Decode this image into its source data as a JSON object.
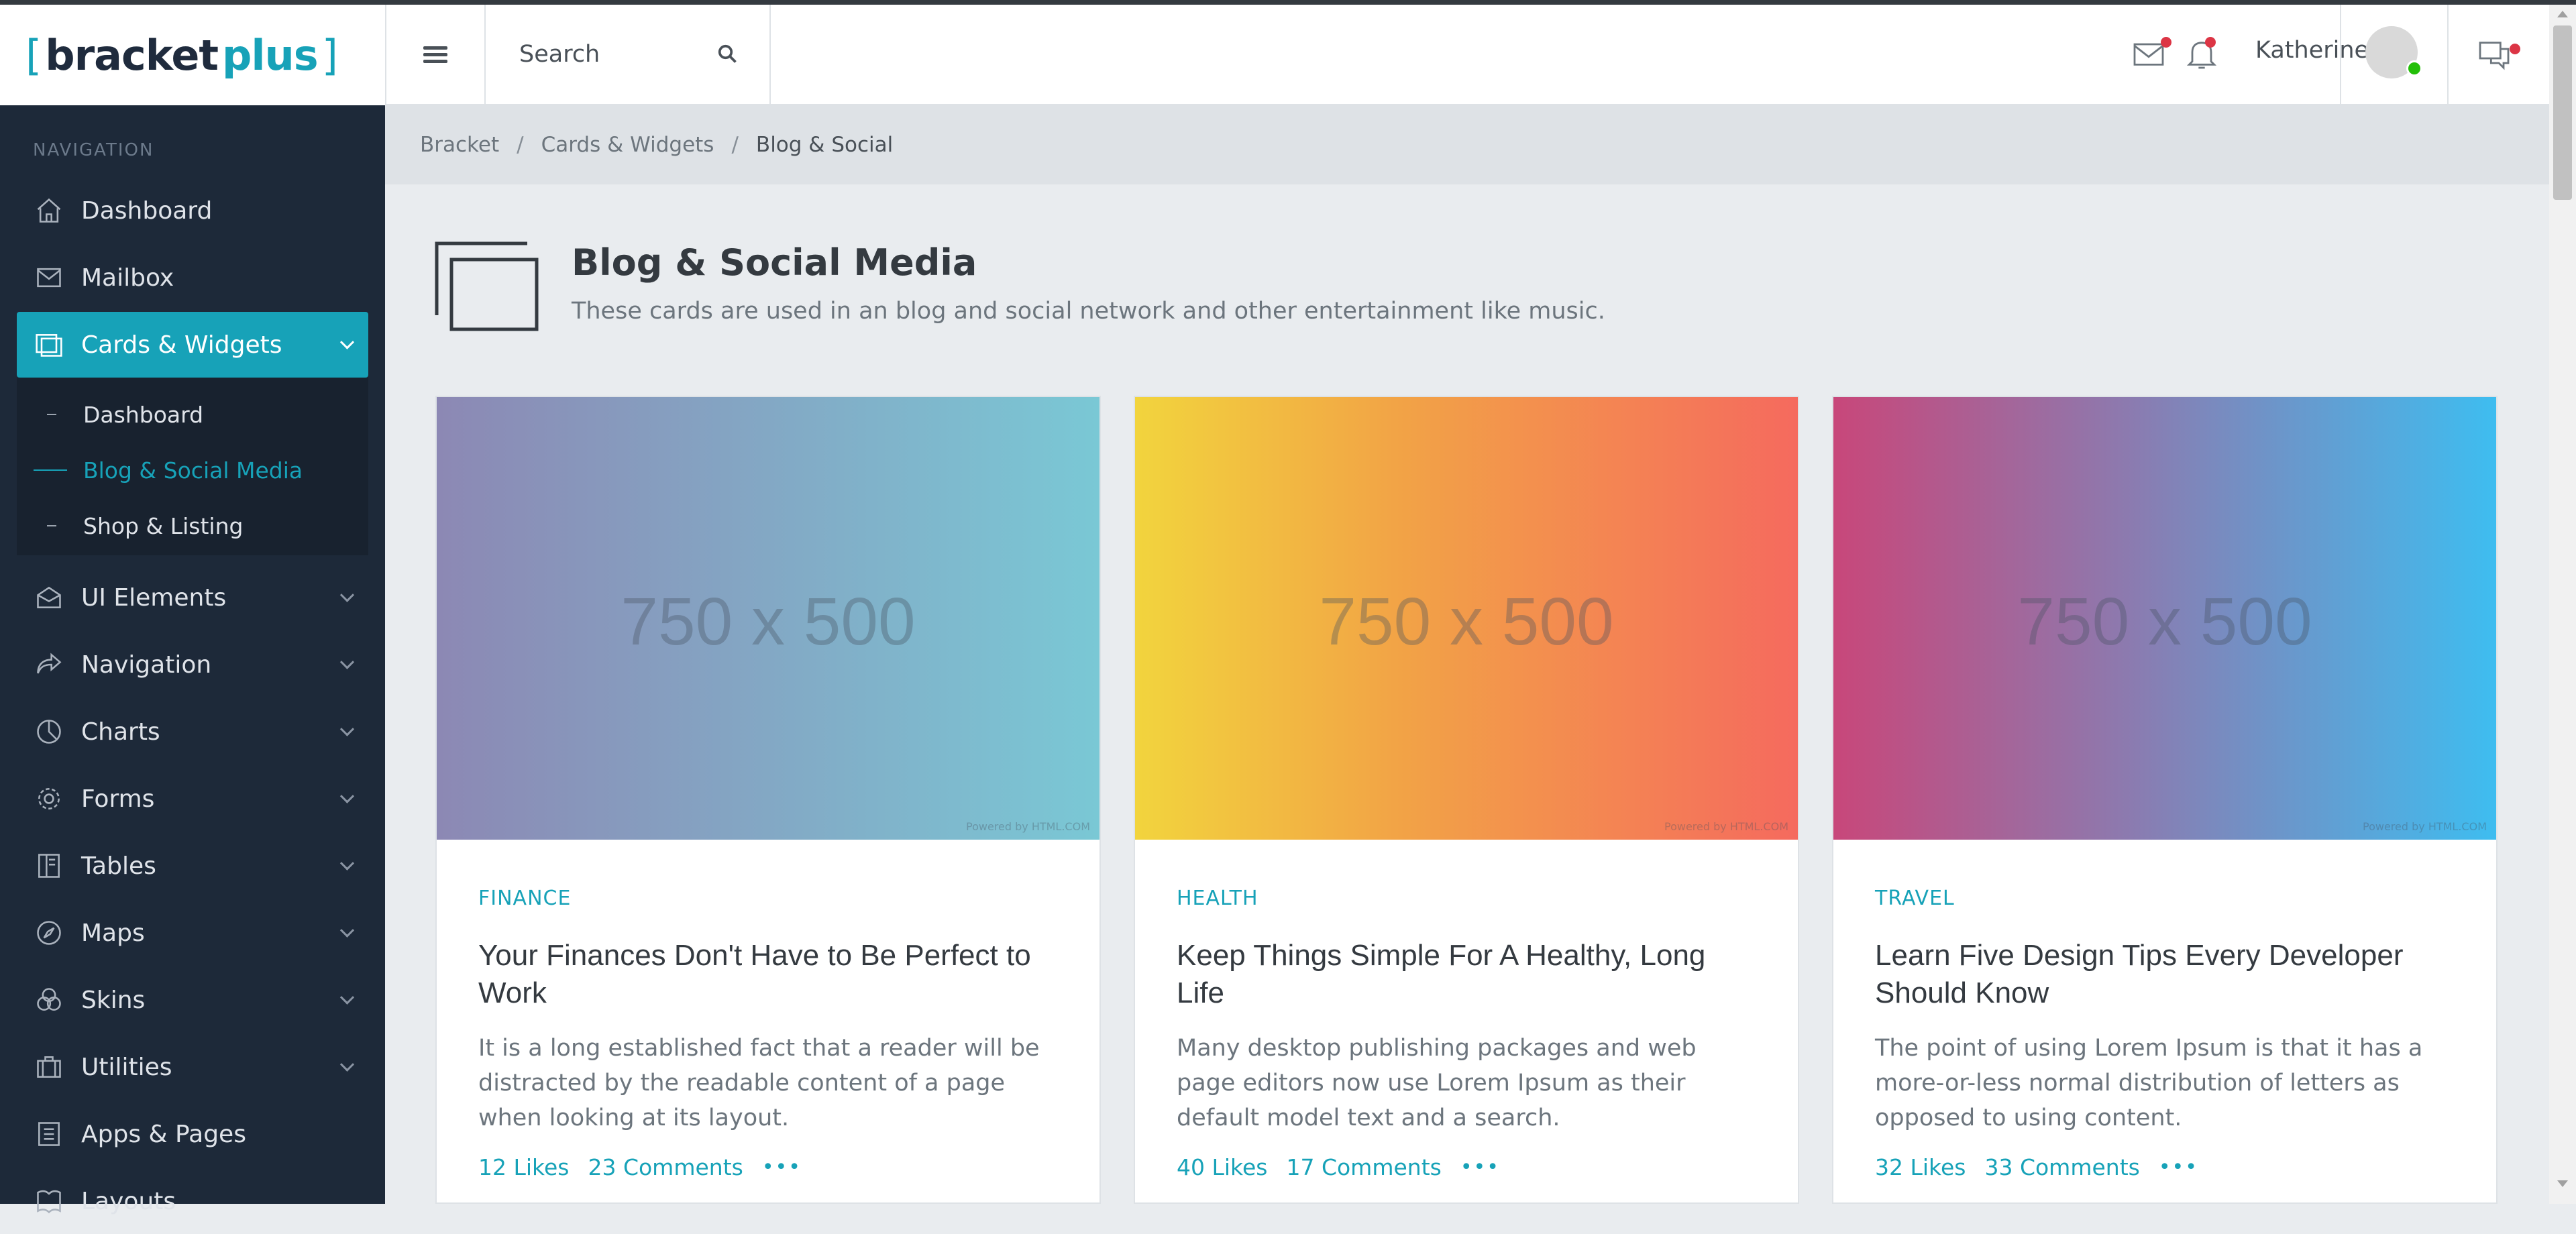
{
  "brand": {
    "bracket_open": "[",
    "name_a": "bracket",
    "name_b": "plus",
    "bracket_close": "]"
  },
  "header": {
    "search_placeholder": "Search",
    "username": "Katherine"
  },
  "sidebar": {
    "nav_label": "NAVIGATION",
    "items": [
      {
        "label": "Dashboard",
        "icon": "home-icon"
      },
      {
        "label": "Mailbox",
        "icon": "mail-icon"
      },
      {
        "label": "Cards & Widgets",
        "icon": "cards-icon",
        "active": true
      },
      {
        "label": "UI Elements",
        "icon": "ui-elements-icon"
      },
      {
        "label": "Navigation",
        "icon": "navigation-icon"
      },
      {
        "label": "Charts",
        "icon": "chart-pie-icon"
      },
      {
        "label": "Forms",
        "icon": "gear-icon"
      },
      {
        "label": "Tables",
        "icon": "table-icon"
      },
      {
        "label": "Maps",
        "icon": "compass-icon"
      },
      {
        "label": "Skins",
        "icon": "skins-icon"
      },
      {
        "label": "Utilities",
        "icon": "briefcase-icon"
      },
      {
        "label": "Apps & Pages",
        "icon": "pages-icon"
      },
      {
        "label": "Layouts",
        "icon": "layouts-icon"
      }
    ],
    "subitems": [
      {
        "label": "Dashboard"
      },
      {
        "label": "Blog & Social Media",
        "active": true
      },
      {
        "label": "Shop & Listing"
      }
    ]
  },
  "breadcrumb": [
    "Bracket",
    "Cards & Widgets",
    "Blog & Social"
  ],
  "page": {
    "title": "Blog & Social Media",
    "subtitle": "These cards are used in an blog and social network and other entertainment like music."
  },
  "cards": [
    {
      "image_text": "750 x 500",
      "powered": "Powered by HTML.COM",
      "category": "FINANCE",
      "title": "Your Finances Don't Have to Be Perfect to Work",
      "text": "It is a long established fact that a reader will be distracted by the readable content of a page when looking at its layout.",
      "likes": "12 Likes",
      "comments": "23 Comments"
    },
    {
      "image_text": "750 x 500",
      "powered": "Powered by HTML.COM",
      "category": "HEALTH",
      "title": "Keep Things Simple For A Healthy, Long Life",
      "text": "Many desktop publishing packages and web page editors now use Lorem Ipsum as their default model text and a search.",
      "likes": "40 Likes",
      "comments": "17 Comments"
    },
    {
      "image_text": "750 x 500",
      "powered": "Powered by HTML.COM",
      "category": "TRAVEL",
      "title": "Learn Five Design Tips Every Developer Should Know",
      "text": "The point of using Lorem Ipsum is that it has a more-or-less normal distribution of letters as opposed to using content.",
      "likes": "32 Likes",
      "comments": "33 Comments"
    }
  ],
  "colors": {
    "accent": "#17a2b8",
    "sidebar_bg": "#1d2939",
    "content_bg": "#e9ecef",
    "badge": "#dc3545"
  }
}
